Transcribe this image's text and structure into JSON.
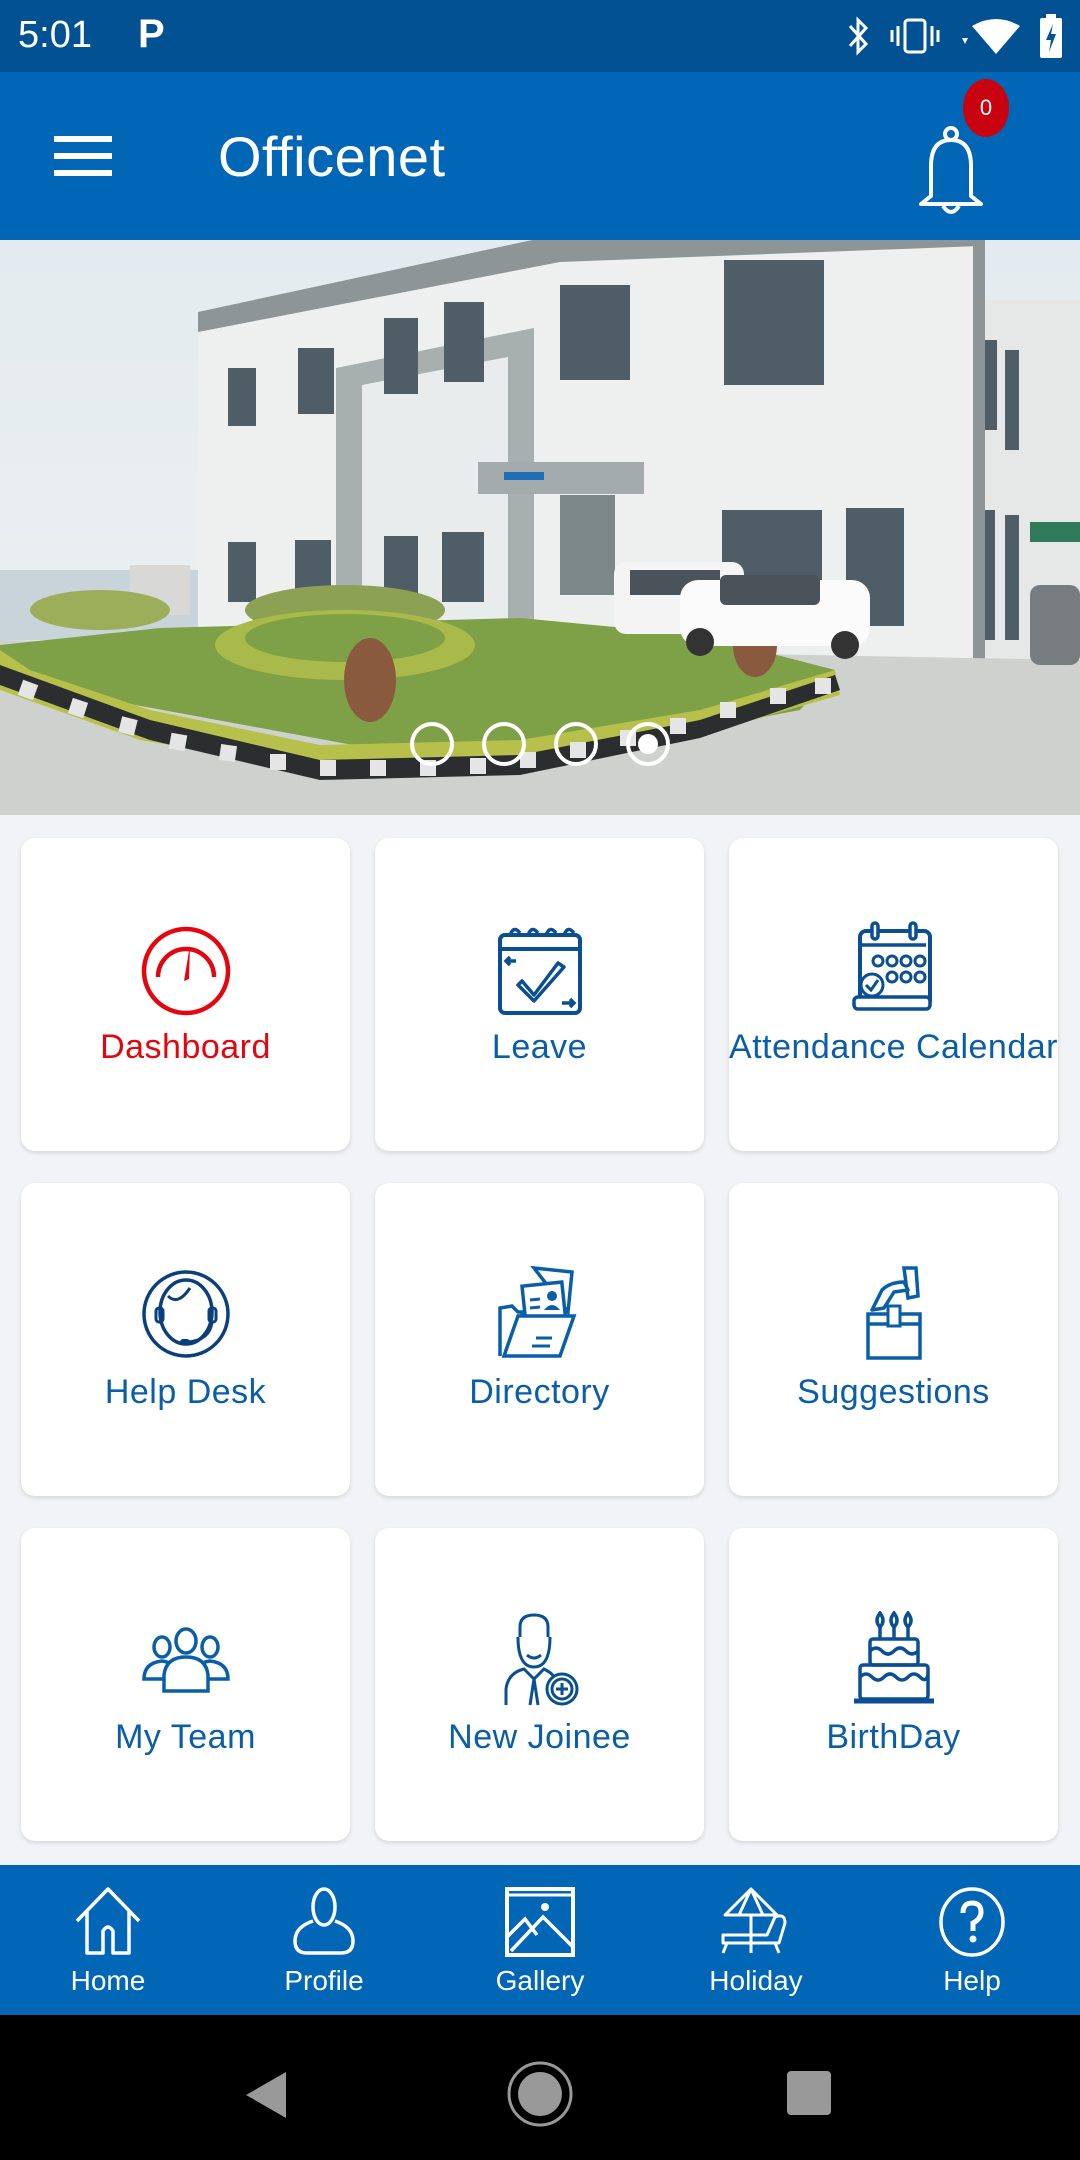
{
  "status_bar": {
    "time": "5:01",
    "notification_icon": "parking-p-icon",
    "icons": [
      "bluetooth-icon",
      "vibrate-icon",
      "wifi-icon",
      "battery-charging-icon"
    ]
  },
  "app_bar": {
    "title": "Officenet",
    "menu_icon": "hamburger-menu-icon",
    "notification_icon": "bell-icon",
    "notification_count": "0"
  },
  "banner": {
    "description": "Office building with landscaped garden",
    "slide_count": 4,
    "active_slide": 4
  },
  "tiles": [
    {
      "label": "Dashboard",
      "icon": "speedometer-icon",
      "active": true
    },
    {
      "label": "Leave",
      "icon": "calendar-check-icon"
    },
    {
      "label": "Attendance Calendar",
      "icon": "attendance-calendar-icon"
    },
    {
      "label": "Help Desk",
      "icon": "headset-agent-icon"
    },
    {
      "label": "Directory",
      "icon": "folder-contact-icon"
    },
    {
      "label": "Suggestions",
      "icon": "ballot-box-icon"
    },
    {
      "label": "My Team",
      "icon": "team-icon"
    },
    {
      "label": "New Joinee",
      "icon": "new-employee-icon"
    },
    {
      "label": "BirthDay",
      "icon": "birthday-cake-icon"
    }
  ],
  "bottom_nav": [
    {
      "label": "Home",
      "icon": "home-icon"
    },
    {
      "label": "Profile",
      "icon": "user-icon"
    },
    {
      "label": "Gallery",
      "icon": "image-icon"
    },
    {
      "label": "Holiday",
      "icon": "beach-umbrella-icon"
    },
    {
      "label": "Help",
      "icon": "help-circle-icon"
    }
  ],
  "colors": {
    "status_bar": "#025193",
    "primary": "#0166b5",
    "tile_text": "#0a5ea8",
    "active_tile": "#e4060f",
    "badge": "#c8020e",
    "background": "#f2f3f6"
  }
}
